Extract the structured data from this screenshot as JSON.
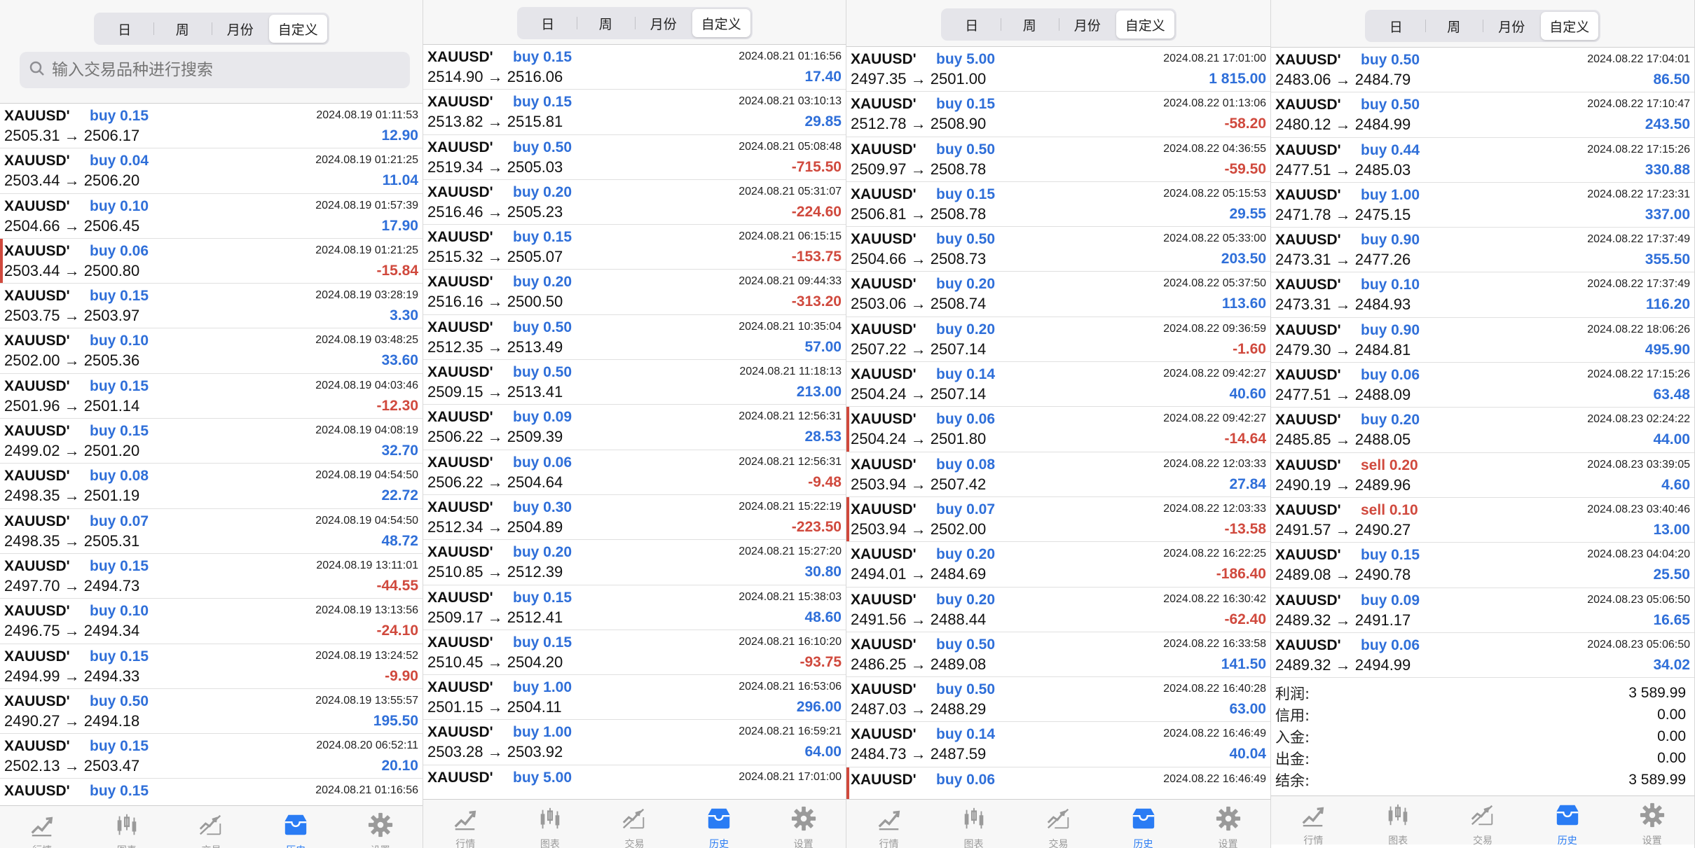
{
  "segments": [
    "日",
    "周",
    "月份",
    "自定义"
  ],
  "search": {
    "placeholder": "输入交易品种进行搜索"
  },
  "tabs": [
    {
      "label": "行情",
      "icon": "quotes-icon"
    },
    {
      "label": "图表",
      "icon": "chart-icon"
    },
    {
      "label": "交易",
      "icon": "trade-icon"
    },
    {
      "label": "历史",
      "icon": "history-icon"
    },
    {
      "label": "设置",
      "icon": "gear-icon"
    }
  ],
  "colors": {
    "profit": "#2f6fd9",
    "loss": "#d0493d",
    "active_tab": "#2a7cf4"
  },
  "panels": [
    {
      "active_segment": 3,
      "active_tab": 3,
      "rows": [
        {
          "symbol": "XAUUSD'",
          "side": "buy 0.15",
          "time": "2024.08.19 01:11:53",
          "price": "2505.31 → 2506.17",
          "pnl": "12.90",
          "neg": false,
          "mark": false
        },
        {
          "symbol": "XAUUSD'",
          "side": "buy 0.04",
          "time": "2024.08.19 01:21:25",
          "price": "2503.44 → 2506.20",
          "pnl": "11.04",
          "neg": false,
          "mark": false
        },
        {
          "symbol": "XAUUSD'",
          "side": "buy 0.10",
          "time": "2024.08.19 01:57:39",
          "price": "2504.66 → 2506.45",
          "pnl": "17.90",
          "neg": false,
          "mark": false
        },
        {
          "symbol": "XAUUSD'",
          "side": "buy 0.06",
          "time": "2024.08.19 01:21:25",
          "price": "2503.44 → 2500.80",
          "pnl": "-15.84",
          "neg": true,
          "mark": true
        },
        {
          "symbol": "XAUUSD'",
          "side": "buy 0.15",
          "time": "2024.08.19 03:28:19",
          "price": "2503.75 → 2503.97",
          "pnl": "3.30",
          "neg": false,
          "mark": false
        },
        {
          "symbol": "XAUUSD'",
          "side": "buy 0.10",
          "time": "2024.08.19 03:48:25",
          "price": "2502.00 → 2505.36",
          "pnl": "33.60",
          "neg": false,
          "mark": false
        },
        {
          "symbol": "XAUUSD'",
          "side": "buy 0.15",
          "time": "2024.08.19 04:03:46",
          "price": "2501.96 → 2501.14",
          "pnl": "-12.30",
          "neg": true,
          "mark": false
        },
        {
          "symbol": "XAUUSD'",
          "side": "buy 0.15",
          "time": "2024.08.19 04:08:19",
          "price": "2499.02 → 2501.20",
          "pnl": "32.70",
          "neg": false,
          "mark": false
        },
        {
          "symbol": "XAUUSD'",
          "side": "buy 0.08",
          "time": "2024.08.19 04:54:50",
          "price": "2498.35 → 2501.19",
          "pnl": "22.72",
          "neg": false,
          "mark": false
        },
        {
          "symbol": "XAUUSD'",
          "side": "buy 0.07",
          "time": "2024.08.19 04:54:50",
          "price": "2498.35 → 2505.31",
          "pnl": "48.72",
          "neg": false,
          "mark": false
        },
        {
          "symbol": "XAUUSD'",
          "side": "buy 0.15",
          "time": "2024.08.19 13:11:01",
          "price": "2497.70 → 2494.73",
          "pnl": "-44.55",
          "neg": true,
          "mark": false
        },
        {
          "symbol": "XAUUSD'",
          "side": "buy 0.10",
          "time": "2024.08.19 13:13:56",
          "price": "2496.75 → 2494.34",
          "pnl": "-24.10",
          "neg": true,
          "mark": false
        },
        {
          "symbol": "XAUUSD'",
          "side": "buy 0.15",
          "time": "2024.08.19 13:24:52",
          "price": "2494.99 → 2494.33",
          "pnl": "-9.90",
          "neg": true,
          "mark": false
        },
        {
          "symbol": "XAUUSD'",
          "side": "buy 0.50",
          "time": "2024.08.19 13:55:57",
          "price": "2490.27 → 2494.18",
          "pnl": "195.50",
          "neg": false,
          "mark": false
        },
        {
          "symbol": "XAUUSD'",
          "side": "buy 0.15",
          "time": "2024.08.20 06:52:11",
          "price": "2502.13 → 2503.47",
          "pnl": "20.10",
          "neg": false,
          "mark": false
        },
        {
          "symbol": "XAUUSD'",
          "side": "buy 0.15",
          "time": "2024.08.21 01:16:56",
          "price": "",
          "pnl": "",
          "neg": false,
          "mark": false
        }
      ],
      "summary": []
    },
    {
      "active_segment": 3,
      "active_tab": 3,
      "rows": [
        {
          "symbol": "XAUUSD'",
          "side": "buy 0.15",
          "time": "2024.08.21 01:16:56",
          "price": "2514.90 → 2516.06",
          "pnl": "17.40",
          "neg": false,
          "mark": false
        },
        {
          "symbol": "XAUUSD'",
          "side": "buy 0.15",
          "time": "2024.08.21 03:10:13",
          "price": "2513.82 → 2515.81",
          "pnl": "29.85",
          "neg": false,
          "mark": false
        },
        {
          "symbol": "XAUUSD'",
          "side": "buy 0.50",
          "time": "2024.08.21 05:08:48",
          "price": "2519.34 → 2505.03",
          "pnl": "-715.50",
          "neg": true,
          "mark": false
        },
        {
          "symbol": "XAUUSD'",
          "side": "buy 0.20",
          "time": "2024.08.21 05:31:07",
          "price": "2516.46 → 2505.23",
          "pnl": "-224.60",
          "neg": true,
          "mark": false
        },
        {
          "symbol": "XAUUSD'",
          "side": "buy 0.15",
          "time": "2024.08.21 06:15:15",
          "price": "2515.32 → 2505.07",
          "pnl": "-153.75",
          "neg": true,
          "mark": false
        },
        {
          "symbol": "XAUUSD'",
          "side": "buy 0.20",
          "time": "2024.08.21 09:44:33",
          "price": "2516.16 → 2500.50",
          "pnl": "-313.20",
          "neg": true,
          "mark": false
        },
        {
          "symbol": "XAUUSD'",
          "side": "buy 0.50",
          "time": "2024.08.21 10:35:04",
          "price": "2512.35 → 2513.49",
          "pnl": "57.00",
          "neg": false,
          "mark": false
        },
        {
          "symbol": "XAUUSD'",
          "side": "buy 0.50",
          "time": "2024.08.21 11:18:13",
          "price": "2509.15 → 2513.41",
          "pnl": "213.00",
          "neg": false,
          "mark": false
        },
        {
          "symbol": "XAUUSD'",
          "side": "buy 0.09",
          "time": "2024.08.21 12:56:31",
          "price": "2506.22 → 2509.39",
          "pnl": "28.53",
          "neg": false,
          "mark": false
        },
        {
          "symbol": "XAUUSD'",
          "side": "buy 0.06",
          "time": "2024.08.21 12:56:31",
          "price": "2506.22 → 2504.64",
          "pnl": "-9.48",
          "neg": true,
          "mark": false
        },
        {
          "symbol": "XAUUSD'",
          "side": "buy 0.30",
          "time": "2024.08.21 15:22:19",
          "price": "2512.34 → 2504.89",
          "pnl": "-223.50",
          "neg": true,
          "mark": false
        },
        {
          "symbol": "XAUUSD'",
          "side": "buy 0.20",
          "time": "2024.08.21 15:27:20",
          "price": "2510.85 → 2512.39",
          "pnl": "30.80",
          "neg": false,
          "mark": false
        },
        {
          "symbol": "XAUUSD'",
          "side": "buy 0.15",
          "time": "2024.08.21 15:38:03",
          "price": "2509.17 → 2512.41",
          "pnl": "48.60",
          "neg": false,
          "mark": false
        },
        {
          "symbol": "XAUUSD'",
          "side": "buy 0.15",
          "time": "2024.08.21 16:10:20",
          "price": "2510.45 → 2504.20",
          "pnl": "-93.75",
          "neg": true,
          "mark": false
        },
        {
          "symbol": "XAUUSD'",
          "side": "buy 1.00",
          "time": "2024.08.21 16:53:06",
          "price": "2501.15 → 2504.11",
          "pnl": "296.00",
          "neg": false,
          "mark": false
        },
        {
          "symbol": "XAUUSD'",
          "side": "buy 1.00",
          "time": "2024.08.21 16:59:21",
          "price": "2503.28 → 2503.92",
          "pnl": "64.00",
          "neg": false,
          "mark": false
        },
        {
          "symbol": "XAUUSD'",
          "side": "buy 5.00",
          "time": "2024.08.21 17:01:00",
          "price": "",
          "pnl": "",
          "neg": false,
          "mark": false
        }
      ],
      "summary": []
    },
    {
      "active_segment": 3,
      "active_tab": 3,
      "rows": [
        {
          "symbol": "XAUUSD'",
          "side": "buy 5.00",
          "time": "2024.08.21 17:01:00",
          "price": "2497.35 → 2501.00",
          "pnl": "1 815.00",
          "neg": false,
          "mark": false
        },
        {
          "symbol": "XAUUSD'",
          "side": "buy 0.15",
          "time": "2024.08.22 01:13:06",
          "price": "2512.78 → 2508.90",
          "pnl": "-58.20",
          "neg": true,
          "mark": false
        },
        {
          "symbol": "XAUUSD'",
          "side": "buy 0.50",
          "time": "2024.08.22 04:36:55",
          "price": "2509.97 → 2508.78",
          "pnl": "-59.50",
          "neg": true,
          "mark": false
        },
        {
          "symbol": "XAUUSD'",
          "side": "buy 0.15",
          "time": "2024.08.22 05:15:53",
          "price": "2506.81 → 2508.78",
          "pnl": "29.55",
          "neg": false,
          "mark": false
        },
        {
          "symbol": "XAUUSD'",
          "side": "buy 0.50",
          "time": "2024.08.22 05:33:00",
          "price": "2504.66 → 2508.73",
          "pnl": "203.50",
          "neg": false,
          "mark": false
        },
        {
          "symbol": "XAUUSD'",
          "side": "buy 0.20",
          "time": "2024.08.22 05:37:50",
          "price": "2503.06 → 2508.74",
          "pnl": "113.60",
          "neg": false,
          "mark": false
        },
        {
          "symbol": "XAUUSD'",
          "side": "buy 0.20",
          "time": "2024.08.22 09:36:59",
          "price": "2507.22 → 2507.14",
          "pnl": "-1.60",
          "neg": true,
          "mark": false
        },
        {
          "symbol": "XAUUSD'",
          "side": "buy 0.14",
          "time": "2024.08.22 09:42:27",
          "price": "2504.24 → 2507.14",
          "pnl": "40.60",
          "neg": false,
          "mark": false
        },
        {
          "symbol": "XAUUSD'",
          "side": "buy 0.06",
          "time": "2024.08.22 09:42:27",
          "price": "2504.24 → 2501.80",
          "pnl": "-14.64",
          "neg": true,
          "mark": true
        },
        {
          "symbol": "XAUUSD'",
          "side": "buy 0.08",
          "time": "2024.08.22 12:03:33",
          "price": "2503.94 → 2507.42",
          "pnl": "27.84",
          "neg": false,
          "mark": false
        },
        {
          "symbol": "XAUUSD'",
          "side": "buy 0.07",
          "time": "2024.08.22 12:03:33",
          "price": "2503.94 → 2502.00",
          "pnl": "-13.58",
          "neg": true,
          "mark": true
        },
        {
          "symbol": "XAUUSD'",
          "side": "buy 0.20",
          "time": "2024.08.22 16:22:25",
          "price": "2494.01 → 2484.69",
          "pnl": "-186.40",
          "neg": true,
          "mark": false
        },
        {
          "symbol": "XAUUSD'",
          "side": "buy 0.20",
          "time": "2024.08.22 16:30:42",
          "price": "2491.56 → 2488.44",
          "pnl": "-62.40",
          "neg": true,
          "mark": false
        },
        {
          "symbol": "XAUUSD'",
          "side": "buy 0.50",
          "time": "2024.08.22 16:33:58",
          "price": "2486.25 → 2489.08",
          "pnl": "141.50",
          "neg": false,
          "mark": false
        },
        {
          "symbol": "XAUUSD'",
          "side": "buy 0.50",
          "time": "2024.08.22 16:40:28",
          "price": "2487.03 → 2488.29",
          "pnl": "63.00",
          "neg": false,
          "mark": false
        },
        {
          "symbol": "XAUUSD'",
          "side": "buy 0.14",
          "time": "2024.08.22 16:46:49",
          "price": "2484.73 → 2487.59",
          "pnl": "40.04",
          "neg": false,
          "mark": false
        },
        {
          "symbol": "XAUUSD'",
          "side": "buy 0.06",
          "time": "2024.08.22 16:46:49",
          "price": "",
          "pnl": "",
          "neg": false,
          "mark": true
        }
      ],
      "summary": []
    },
    {
      "active_segment": 3,
      "active_tab": 3,
      "rows": [
        {
          "symbol": "XAUUSD'",
          "side": "buy 0.50",
          "time": "2024.08.22 17:04:01",
          "price": "2483.06 → 2484.79",
          "pnl": "86.50",
          "neg": false,
          "mark": false
        },
        {
          "symbol": "XAUUSD'",
          "side": "buy 0.50",
          "time": "2024.08.22 17:10:47",
          "price": "2480.12 → 2484.99",
          "pnl": "243.50",
          "neg": false,
          "mark": false
        },
        {
          "symbol": "XAUUSD'",
          "side": "buy 0.44",
          "time": "2024.08.22 17:15:26",
          "price": "2477.51 → 2485.03",
          "pnl": "330.88",
          "neg": false,
          "mark": false
        },
        {
          "symbol": "XAUUSD'",
          "side": "buy 1.00",
          "time": "2024.08.22 17:23:31",
          "price": "2471.78 → 2475.15",
          "pnl": "337.00",
          "neg": false,
          "mark": false
        },
        {
          "symbol": "XAUUSD'",
          "side": "buy 0.90",
          "time": "2024.08.22 17:37:49",
          "price": "2473.31 → 2477.26",
          "pnl": "355.50",
          "neg": false,
          "mark": false
        },
        {
          "symbol": "XAUUSD'",
          "side": "buy 0.10",
          "time": "2024.08.22 17:37:49",
          "price": "2473.31 → 2484.93",
          "pnl": "116.20",
          "neg": false,
          "mark": false
        },
        {
          "symbol": "XAUUSD'",
          "side": "buy 0.90",
          "time": "2024.08.22 18:06:26",
          "price": "2479.30 → 2484.81",
          "pnl": "495.90",
          "neg": false,
          "mark": false
        },
        {
          "symbol": "XAUUSD'",
          "side": "buy 0.06",
          "time": "2024.08.22 17:15:26",
          "price": "2477.51 → 2488.09",
          "pnl": "63.48",
          "neg": false,
          "mark": false
        },
        {
          "symbol": "XAUUSD'",
          "side": "buy 0.20",
          "time": "2024.08.23 02:24:22",
          "price": "2485.85 → 2488.05",
          "pnl": "44.00",
          "neg": false,
          "mark": false
        },
        {
          "symbol": "XAUUSD'",
          "side": "sell 0.20",
          "time": "2024.08.23 03:39:05",
          "price": "2490.19 → 2489.96",
          "pnl": "4.60",
          "neg": false,
          "mark": false,
          "sell": true
        },
        {
          "symbol": "XAUUSD'",
          "side": "sell 0.10",
          "time": "2024.08.23 03:40:46",
          "price": "2491.57 → 2490.27",
          "pnl": "13.00",
          "neg": false,
          "mark": false,
          "sell": true
        },
        {
          "symbol": "XAUUSD'",
          "side": "buy 0.15",
          "time": "2024.08.23 04:04:20",
          "price": "2489.08 → 2490.78",
          "pnl": "25.50",
          "neg": false,
          "mark": false
        },
        {
          "symbol": "XAUUSD'",
          "side": "buy 0.09",
          "time": "2024.08.23 05:06:50",
          "price": "2489.32 → 2491.17",
          "pnl": "16.65",
          "neg": false,
          "mark": false
        },
        {
          "symbol": "XAUUSD'",
          "side": "buy 0.06",
          "time": "2024.08.23 05:06:50",
          "price": "2489.32 → 2494.99",
          "pnl": "34.02",
          "neg": false,
          "mark": false
        }
      ],
      "summary": [
        {
          "label": "利润:",
          "value": "3 589.99"
        },
        {
          "label": "信用:",
          "value": "0.00"
        },
        {
          "label": "入金:",
          "value": "0.00"
        },
        {
          "label": "出金:",
          "value": "0.00"
        },
        {
          "label": "结余:",
          "value": "3 589.99"
        }
      ]
    }
  ]
}
